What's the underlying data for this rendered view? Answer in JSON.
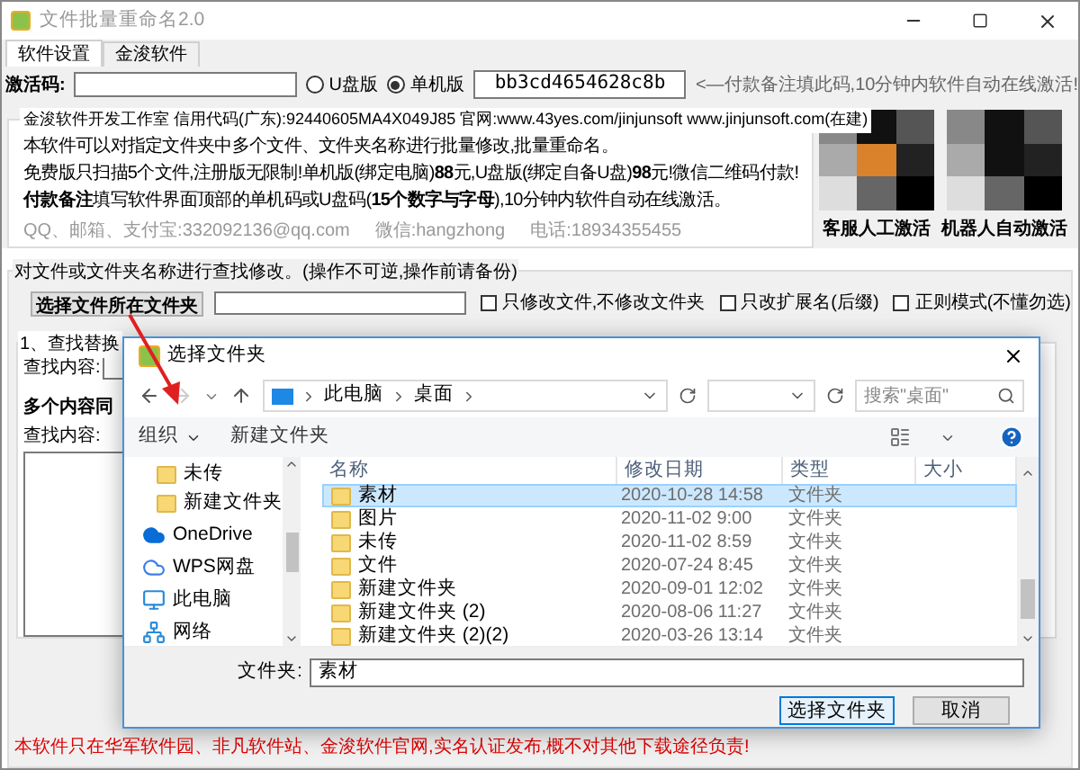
{
  "window": {
    "title": "文件批量重命名2.0"
  },
  "tabs": [
    {
      "label": "软件设置",
      "selected": true
    },
    {
      "label": "金浚软件",
      "selected": false
    }
  ],
  "activation": {
    "label": "激活码:",
    "editions": [
      {
        "label": "U盘版",
        "selected": false
      },
      {
        "label": "单机版",
        "selected": true
      }
    ],
    "machine_code": "bb3cd4654628c8b",
    "note": "<—付款备注填此码,10分钟内软件自动在线激活!"
  },
  "info": {
    "legend": "金浚软件开发工作室 信用代码(广东):92440605MA4X049J85 官网:www.43yes.com/jinjunsoft  www.jinjunsoft.com(在建)",
    "lines": [
      "本软件可以对指定文件夹中多个文件、文件夹名称进行批量修改,批量重命名。",
      "免费版只扫描5个文件,注册版无限制!单机版(绑定电脑)**88**元,U盘版(绑定自备U盘)**98**元!微信二维码付款!",
      "**付款备注**填写软件界面顶部的单机码或U盘码(**15个数字与字母**),10分钟内软件自动在线激活。"
    ],
    "contacts": [
      "QQ、邮箱、支付宝:332092136@qq.com",
      "微信:hangzhong",
      "电话:18934355455"
    ]
  },
  "qr_codes": [
    {
      "label": "客服人工激活"
    },
    {
      "label": "机器人自动激活"
    }
  ],
  "rename": {
    "legend": "对文件或文件夹名称进行查找修改。(操作不可逆,操作前请备份)",
    "choose_button": "选择文件所在文件夹",
    "options": [
      {
        "label": "只修改文件,不修改文件夹",
        "checked": false
      },
      {
        "label": "只改扩展名(后缀)",
        "checked": false
      },
      {
        "label": "正则模式(不懂勿选)",
        "checked": false
      }
    ]
  },
  "find_replace": {
    "legend": "1、查找替换",
    "find_label": "查找内容:",
    "multi_title": "多个内容同",
    "multi_find_label": "查找内容:"
  },
  "footer": "本软件只在华军软件园、非凡软件站、金浚软件官网,实名认证发布,概不对其他下载途径负责!",
  "dialog": {
    "title": "选择文件夹",
    "breadcrumb": [
      "此电脑",
      "桌面"
    ],
    "search_placeholder": "搜索\"桌面\"",
    "organize": "组织",
    "new_folder": "新建文件夹",
    "nav_items": [
      {
        "kind": "folder",
        "label": "未传"
      },
      {
        "kind": "folder",
        "label": "新建文件夹"
      },
      {
        "kind": "cloud",
        "label": "OneDrive"
      },
      {
        "kind": "wps",
        "label": "WPS网盘"
      },
      {
        "kind": "computer",
        "label": "此电脑"
      },
      {
        "kind": "network",
        "label": "网络"
      }
    ],
    "columns": [
      "名称",
      "修改日期",
      "类型",
      "大小"
    ],
    "rows": [
      {
        "name": "素材",
        "modified": "2020-10-28 14:58",
        "type": "文件夹",
        "selected": true
      },
      {
        "name": "图片",
        "modified": "2020-11-02 9:00",
        "type": "文件夹",
        "selected": false
      },
      {
        "name": "未传",
        "modified": "2020-11-02 8:59",
        "type": "文件夹",
        "selected": false
      },
      {
        "name": "文件",
        "modified": "2020-07-24 8:45",
        "type": "文件夹",
        "selected": false
      },
      {
        "name": "新建文件夹",
        "modified": "2020-09-01 12:02",
        "type": "文件夹",
        "selected": false
      },
      {
        "name": "新建文件夹 (2)",
        "modified": "2020-08-06 11:27",
        "type": "文件夹",
        "selected": false
      },
      {
        "name": "新建文件夹 (2)(2)",
        "modified": "2020-03-26 13:14",
        "type": "文件夹",
        "selected": false
      }
    ],
    "folder_label": "文件夹:",
    "folder_value": "素材",
    "ok": "选择文件夹",
    "cancel": "取消"
  }
}
